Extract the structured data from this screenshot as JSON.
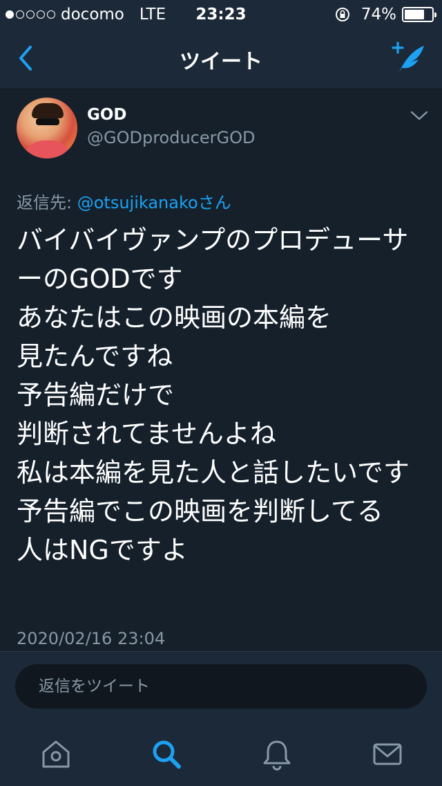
{
  "status_bar": {
    "carrier": "docomo",
    "network": "LTE",
    "time": "23:23",
    "battery": "74%",
    "battery_level": 0.74,
    "signal_bars": 1
  },
  "nav": {
    "title": "ツイート",
    "back_icon": "chevron-left-icon",
    "compose_icon": "compose-feather-icon"
  },
  "tweet": {
    "display_name": "GOD",
    "handle": "@GODproducerGOD",
    "reply_prefix": "返信先: ",
    "reply_mention": "@otsujikanakoさん",
    "text": "バイバイヴァンプのプロデューサーのGODです\nあなたはこの映画の本編を\n見たんですね\n予告編だけで\n判断されてませんよね\n私は本編を見た人と話したいです\n予告編でこの映画を判断してる\n人はNGですよ",
    "timestamp": "2020/02/16 23:04"
  },
  "reply_bar": {
    "placeholder": "返信をツイート"
  },
  "tab_bar": {
    "items": [
      "home-icon",
      "search-icon",
      "notifications-bell-icon",
      "messages-mail-icon"
    ],
    "active": "search-icon"
  },
  "colors": {
    "background": "#15202b",
    "bar": "#1c2938",
    "accent": "#1da1f2",
    "secondary_text": "#8899a6"
  }
}
